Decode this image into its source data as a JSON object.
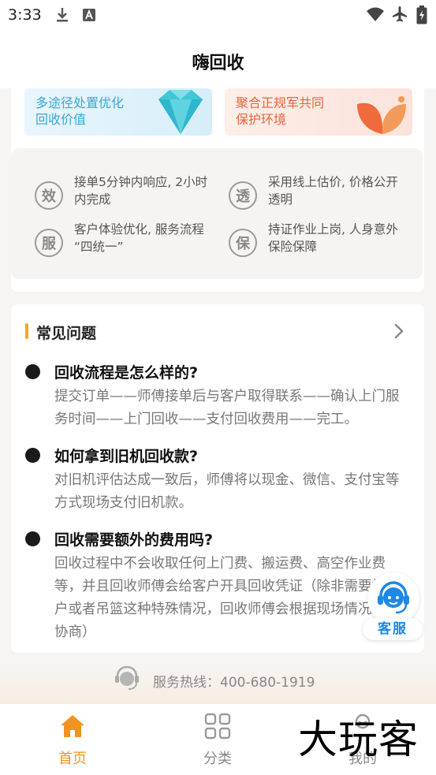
{
  "status_bar": {
    "time": "3:33"
  },
  "app_bar": {
    "title": "嗨回收"
  },
  "promos": [
    {
      "text_line1": "多途径处置优化",
      "text_line2": "回收价值",
      "icon": "diamond-icon",
      "color": "#3aa7d8"
    },
    {
      "text_line1": "聚合正规军共同",
      "text_line2": "保护环境",
      "icon": "leaf-icon",
      "color": "#e8643c"
    }
  ],
  "features": [
    {
      "badge": "效",
      "text": "接单5分钟内响应, 2小时内完成"
    },
    {
      "badge": "透",
      "text": "采用线上估价, 价格公开透明"
    },
    {
      "badge": "服",
      "text": "客户体验优化, 服务流程 “四统一”"
    },
    {
      "badge": "保",
      "text": "持证作业上岗, 人身意外保险保障"
    }
  ],
  "faq": {
    "title": "常见问题",
    "items": [
      {
        "question": "回收流程是怎么样的?",
        "answer": "提交订单——师傅接单后与客户取得联系——确认上门服务时间——上门回收——支付回收费用——完工。"
      },
      {
        "question": "如何拿到旧机回收款?",
        "answer": "对旧机评估达成一致后，师傅将以现金、微信、支付宝等方式现场支付旧机款。"
      },
      {
        "question": "回收需要额外的费用吗?",
        "answer": "回收过程中不会收取任何上门费、搬运费、高空作业费等，并且回收师傅会给客户开具回收凭证（除非需要拆窗户或者吊篮这种特殊情况，回收师傅会根据现场情况跟您协商）"
      }
    ]
  },
  "customer_service": {
    "label": "客服",
    "icon": "headset-icon"
  },
  "hotline": {
    "text": "服务热线：400-680-1919",
    "icon": "headset-icon"
  },
  "tabs": [
    {
      "label": "首页",
      "icon": "home-icon",
      "active": true
    },
    {
      "label": "分类",
      "icon": "grid-icon",
      "active": false
    },
    {
      "label": "我的",
      "icon": "user-icon",
      "active": false
    }
  ],
  "watermark": {
    "text": "大玩客"
  },
  "colors": {
    "accent": "#f5a623",
    "active_tab": "#f0941f",
    "service_blue": "#1e88e5"
  }
}
